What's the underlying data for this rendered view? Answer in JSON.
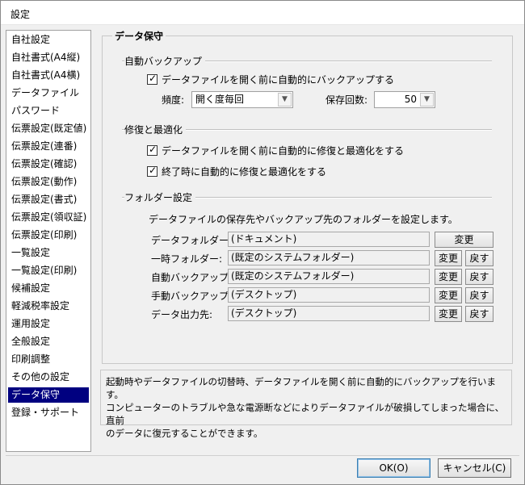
{
  "window": {
    "title": "設定"
  },
  "sidebar": {
    "items": [
      {
        "label": "自社設定"
      },
      {
        "label": "自社書式(A4縦)"
      },
      {
        "label": "自社書式(A4横)"
      },
      {
        "label": "データファイル"
      },
      {
        "label": "パスワード"
      },
      {
        "label": "伝票設定(既定値)"
      },
      {
        "label": "伝票設定(連番)"
      },
      {
        "label": "伝票設定(確認)"
      },
      {
        "label": "伝票設定(動作)"
      },
      {
        "label": "伝票設定(書式)"
      },
      {
        "label": "伝票設定(領収証)"
      },
      {
        "label": "伝票設定(印刷)"
      },
      {
        "label": "一覧設定"
      },
      {
        "label": "一覧設定(印刷)"
      },
      {
        "label": "候補設定"
      },
      {
        "label": "軽減税率設定"
      },
      {
        "label": "運用設定"
      },
      {
        "label": "全般設定"
      },
      {
        "label": "印刷調整"
      },
      {
        "label": "その他の設定"
      },
      {
        "label": "データ保守"
      },
      {
        "label": "登録・サポート"
      }
    ],
    "selected_index": 20
  },
  "main": {
    "group_title": "データ保守",
    "auto_backup": {
      "section_label": "自動バックアップ",
      "checkbox_label": "データファイルを開く前に自動的にバックアップする",
      "checked": true,
      "frequency_label": "頻度:",
      "frequency_value": "開く度毎回",
      "count_label": "保存回数:",
      "count_value": "50"
    },
    "repair": {
      "section_label": "修復と最適化",
      "checkbox1_label": "データファイルを開く前に自動的に修復と最適化をする",
      "checkbox1_checked": true,
      "checkbox2_label": "終了時に自動的に修復と最適化をする",
      "checkbox2_checked": true
    },
    "folders": {
      "section_label": "フォルダー設定",
      "description": "データファイルの保存先やバックアップ先のフォルダーを設定します。",
      "change_label": "変更",
      "reset_label": "戻す",
      "rows": [
        {
          "label": "データフォルダー:",
          "value": "(ドキュメント)"
        },
        {
          "label": "一時フォルダー:",
          "value": "(既定のシステムフォルダー)"
        },
        {
          "label": "自動バックアップ:",
          "value": "(既定のシステムフォルダー)"
        },
        {
          "label": "手動バックアップ:",
          "value": "(デスクトップ)"
        },
        {
          "label": "データ出力先:",
          "value": "(デスクトップ)"
        }
      ]
    }
  },
  "description": {
    "line1": "起動時やデータファイルの切替時、データファイルを開く前に自動的にバックアップを行います。",
    "line2": "コンピューターのトラブルや急な電源断などによりデータファイルが破損してしまった場合に、直前",
    "line3": "のデータに復元することができます。"
  },
  "footer": {
    "ok_label": "OK(O)",
    "cancel_label": "キャンセル(C)"
  },
  "icons": {
    "check": "check-mark-icon",
    "dropdown": "chevron-down-icon"
  }
}
